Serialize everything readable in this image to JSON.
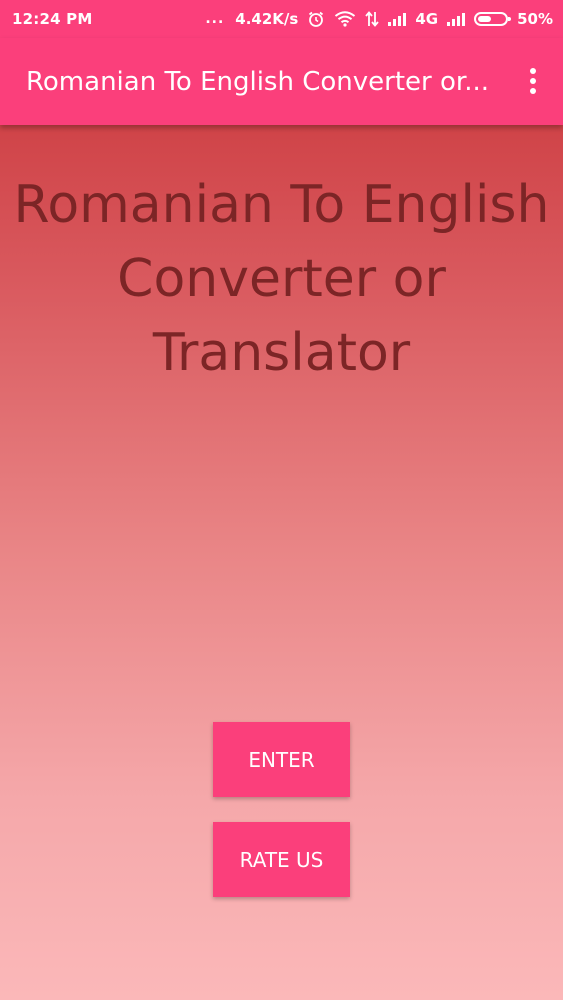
{
  "status_bar": {
    "time": "12:24 PM",
    "dots": "...",
    "speed": "4.42K/s",
    "network": "4G",
    "battery": "50%",
    "battery_level": 0.5,
    "icons": [
      "alarm-icon",
      "wifi-icon",
      "data-arrows-icon",
      "signal-icon",
      "signal-icon",
      "battery-icon"
    ]
  },
  "app_bar": {
    "title": "Romanian To English Converter or Translator",
    "menu_icon": "more-vert-icon"
  },
  "main": {
    "heading": "Romanian To English Converter or Translator"
  },
  "buttons": {
    "enter_label": "ENTER",
    "rate_label": "RATE US"
  },
  "colors": {
    "primary": "#fb3f7b",
    "heading_text": "#7c2526",
    "background_top": "#c83236",
    "background_bottom": "#fbb8b9"
  }
}
